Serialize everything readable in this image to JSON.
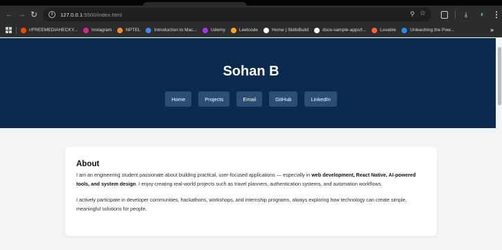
{
  "browser": {
    "url_host": "127.0.0.1",
    "url_path": ":5500/index.html",
    "bookmarks": [
      {
        "label": "r/FREEMEDIAHECKY...",
        "color": "#ff4500"
      },
      {
        "label": "Instagram",
        "color": "#d6249f"
      },
      {
        "label": "NPTEL",
        "color": "#f28c28"
      },
      {
        "label": "Introduction to Mac...",
        "color": "#4285f4"
      },
      {
        "label": "Udemy",
        "color": "#a435f0"
      },
      {
        "label": "Leetcode",
        "color": "#ffa116"
      },
      {
        "label": "Home | SkillsBuild",
        "color": "#ffffff"
      },
      {
        "label": "dsce-sample-apps/t...",
        "color": "#ffffff"
      },
      {
        "label": "Lovable",
        "color": "#ff5e3a"
      },
      {
        "label": "Unleashing the Pow...",
        "color": "#1e90ff"
      }
    ],
    "overflow_label": "»"
  },
  "site": {
    "title": "Sohan B",
    "nav": [
      "Home",
      "Projects",
      "Email",
      "GitHub",
      "LinkedIn"
    ]
  },
  "about": {
    "heading": "About",
    "p1_a": "I am an engineering student passionate about building practical, user-focused applications — especially in ",
    "p1_b": "web development, React Native, AI-powered tools, and system design",
    "p1_c": ". I enjoy creating real-world projects such as travel planners, authentication systems, and automation workflows.",
    "p2": "I actively participate in developer communities, hackathons, workshops, and internship programs, always exploring how technology can create simple, meaningful solutions for people."
  },
  "colors": {
    "hero_bg": "#0b2a4f",
    "nav_button_bg": "#2b4e75",
    "page_bg": "#f3f4f6"
  }
}
